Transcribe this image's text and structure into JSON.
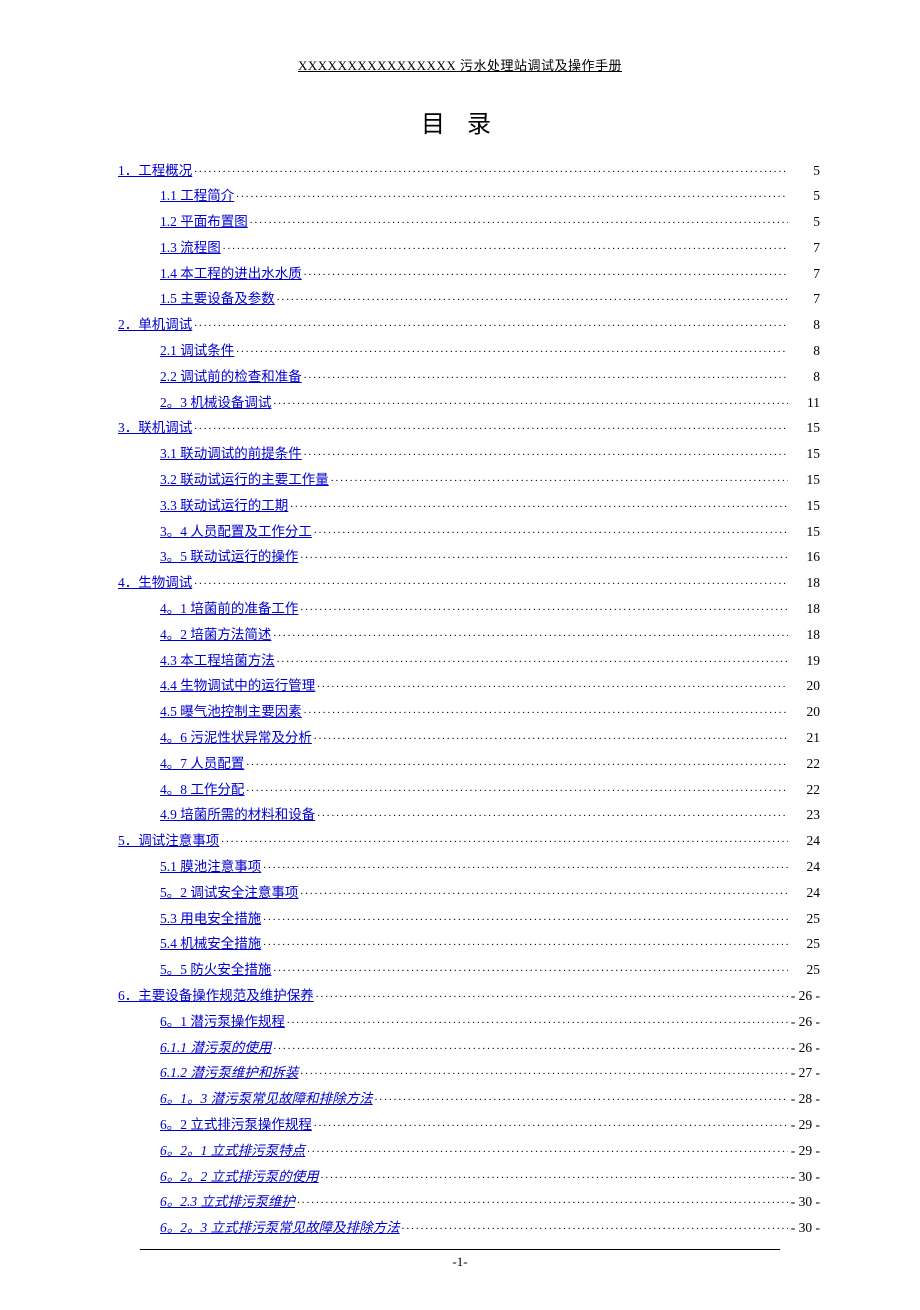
{
  "header": "XXXXXXXXXXXXXXXX 污水处理站调试及操作手册",
  "title": "目 录",
  "footer_page": "-1-",
  "toc": [
    {
      "level": 0,
      "label": "1．工程概况",
      "page": "5"
    },
    {
      "level": 1,
      "label": "1.1 工程简介",
      "page": "5"
    },
    {
      "level": 1,
      "label": "1.2 平面布置图",
      "page": "5"
    },
    {
      "level": 1,
      "label": "1.3  流程图",
      "page": "7"
    },
    {
      "level": 1,
      "label": "1.4 本工程的进出水水质",
      "page": "7"
    },
    {
      "level": 1,
      "label": "1.5 主要设备及参数",
      "page": "7"
    },
    {
      "level": 0,
      "label": "2．单机调试",
      "page": "8"
    },
    {
      "level": 1,
      "label": "2.1 调试条件",
      "page": "8"
    },
    {
      "level": 1,
      "label": "2.2 调试前的检查和准备",
      "page": "8"
    },
    {
      "level": 1,
      "label": "2。3 机械设备调试",
      "page": "11"
    },
    {
      "level": 0,
      "label": "3．联机调试",
      "page": "15"
    },
    {
      "level": 1,
      "label": "3.1 联动调试的前提条件",
      "page": "15"
    },
    {
      "level": 1,
      "label": "3.2 联动试运行的主要工作量",
      "page": "15"
    },
    {
      "level": 1,
      "label": "3.3 联动试运行的工期",
      "page": "15"
    },
    {
      "level": 1,
      "label": "3。4 人员配置及工作分工",
      "page": "15"
    },
    {
      "level": 1,
      "label": "3。5 联动试运行的操作",
      "page": "16"
    },
    {
      "level": 0,
      "label": "4．生物调试",
      "page": "18"
    },
    {
      "level": 1,
      "label": "4。1 培菌前的准备工作",
      "page": "18"
    },
    {
      "level": 1,
      "label": "4。2 培菌方法简述",
      "page": "18"
    },
    {
      "level": 1,
      "label": "4.3 本工程培菌方法",
      "page": "19"
    },
    {
      "level": 1,
      "label": "4.4  生物调试中的运行管理",
      "page": "20"
    },
    {
      "level": 1,
      "label": "4.5  曝气池控制主要因素",
      "page": "20"
    },
    {
      "level": 1,
      "label": "4。6  污泥性状异常及分析",
      "page": "21"
    },
    {
      "level": 1,
      "label": "4。7  人员配置",
      "page": "22"
    },
    {
      "level": 1,
      "label": "4。8  工作分配",
      "page": "22"
    },
    {
      "level": 1,
      "label": "4.9  培菌所需的材料和设备",
      "page": "23"
    },
    {
      "level": 0,
      "label": "5．调试注意事项",
      "page": "24"
    },
    {
      "level": 1,
      "label": "5.1 膜池注意事项",
      "page": "24"
    },
    {
      "level": 1,
      "label": "5。2 调试安全注意事项",
      "page": "24"
    },
    {
      "level": 1,
      "label": "5.3 用电安全措施",
      "page": "25"
    },
    {
      "level": 1,
      "label": "5.4 机械安全措施",
      "page": "25"
    },
    {
      "level": 1,
      "label": "5。5 防火安全措施",
      "page": "25"
    },
    {
      "level": 0,
      "label": "6．主要设备操作规范及维护保养",
      "page": "- 26 -"
    },
    {
      "level": 1,
      "label": "6。1 潜污泵操作规程",
      "page": "- 26 -"
    },
    {
      "level": 2,
      "label": "6.1.1 潜污泵的使用",
      "page": "- 26 -"
    },
    {
      "level": 2,
      "label": "6.1.2 潜污泵维护和拆装",
      "page": "- 27 -"
    },
    {
      "level": 2,
      "label": "6。1。3 潜污泵常见故障和排除方法",
      "page": "- 28 -"
    },
    {
      "level": 1,
      "label": "6。2 立式排污泵操作规程",
      "page": "- 29 -"
    },
    {
      "level": 2,
      "label": "6。2。1 立式排污泵特点",
      "page": "- 29 -"
    },
    {
      "level": 2,
      "label": "6。2。2 立式排污泵的使用",
      "page": "- 30 -"
    },
    {
      "level": 2,
      "label": "6。2.3 立式排污泵维护",
      "page": "- 30 -"
    },
    {
      "level": 2,
      "label": "6。2。3 立式排污泵常见故障及排除方法",
      "page": "- 30 -"
    }
  ]
}
